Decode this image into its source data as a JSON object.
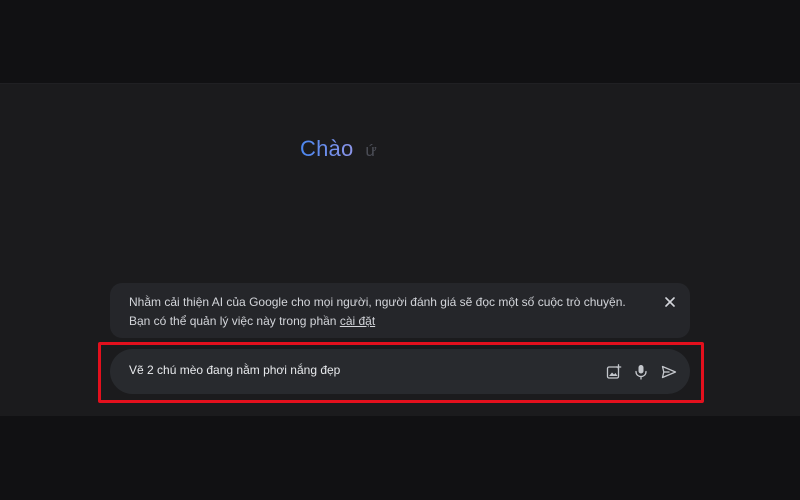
{
  "greeting": {
    "word": "Chào",
    "name": "ứ"
  },
  "notice": {
    "text": "Nhằm cải thiện AI của Google cho mọi người, người đánh giá sẽ đọc một số cuộc trò chuyện. Bạn có thể quản lý việc này trong phần ",
    "link_label": "cài đặt",
    "close_icon": "close-icon"
  },
  "prompt": {
    "value": "Vẽ 2 chú mèo đang nằm phơi nắng đẹp",
    "icons": [
      "add-image-icon",
      "microphone-icon",
      "send-icon"
    ]
  },
  "colors": {
    "background": "#1b1b1d",
    "surface": "#282a2e",
    "highlight": "#e3101d",
    "gradient_start": "#4a86f0",
    "gradient_end": "#8c95e8"
  }
}
